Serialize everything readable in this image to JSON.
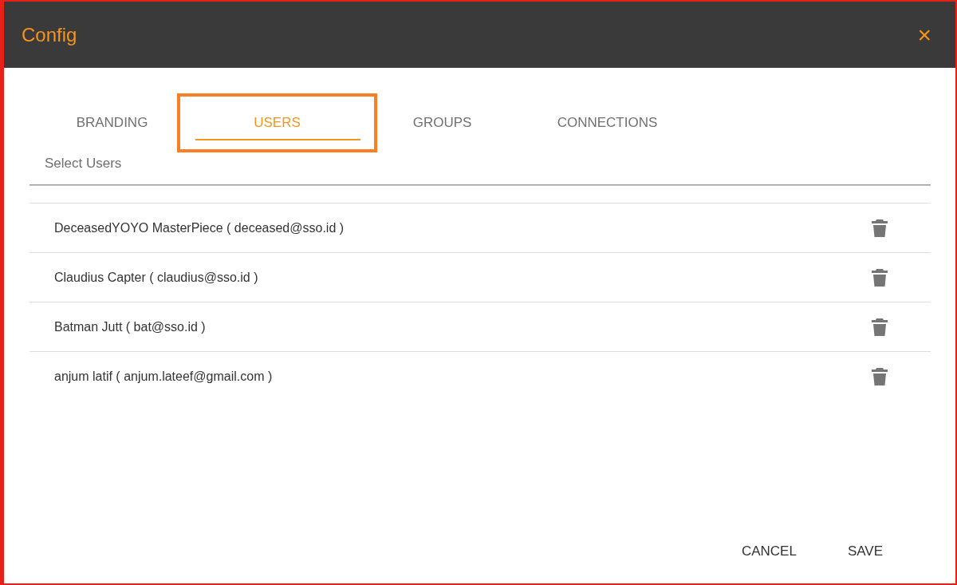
{
  "window": {
    "title": "Config",
    "close": "×"
  },
  "tabs": [
    {
      "label": "BRANDING",
      "selected": false
    },
    {
      "label": "USERS",
      "selected": true
    },
    {
      "label": "GROUPS",
      "selected": false
    },
    {
      "label": "CONNECTIONS",
      "selected": false
    }
  ],
  "search": {
    "placeholder": "Select Users"
  },
  "users": [
    {
      "label": "DeceasedYOYO MasterPiece ( deceased@sso.id )"
    },
    {
      "label": "Claudius Capter ( claudius@sso.id )"
    },
    {
      "label": "Batman Jutt ( bat@sso.id )"
    },
    {
      "label": "anjum latif ( anjum.lateef@gmail.com )"
    }
  ],
  "buttons": [
    "CANCEL",
    "SAVE"
  ]
}
